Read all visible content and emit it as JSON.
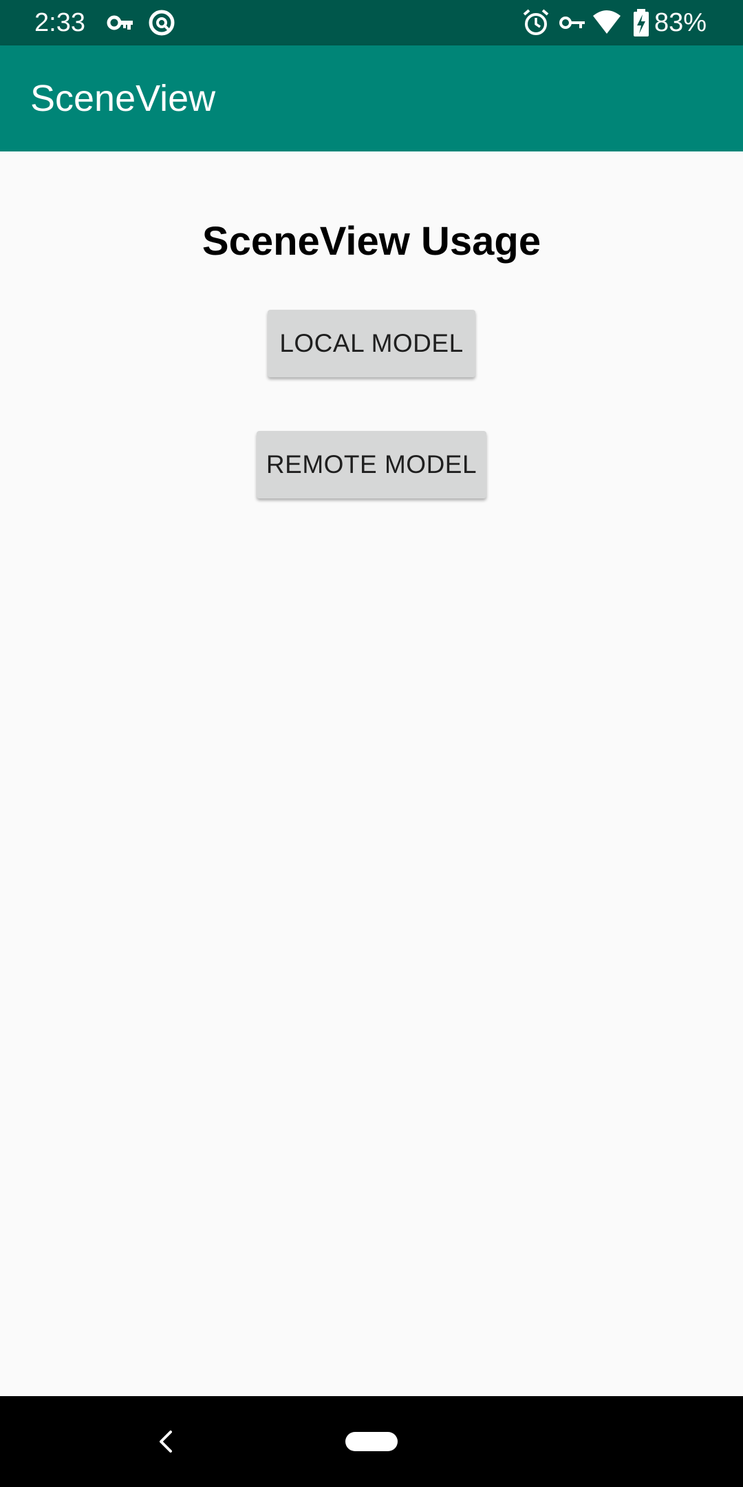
{
  "status_bar": {
    "time": "2:33",
    "battery_percent": "83%",
    "left_icons": [
      "vpn-key-icon",
      "data-saver-icon"
    ],
    "right_icons": [
      "alarm-icon",
      "vpn-key-icon",
      "wifi-icon",
      "battery-charging-icon"
    ],
    "background_color": "#00574b"
  },
  "app_bar": {
    "title": "SceneView",
    "background_color": "#008577"
  },
  "main": {
    "heading": "SceneView Usage",
    "buttons": {
      "local_model": "LOCAL MODEL",
      "remote_model": "REMOTE MODEL"
    }
  },
  "nav_bar": {
    "icons": [
      "back-icon",
      "home-pill-icon"
    ]
  }
}
